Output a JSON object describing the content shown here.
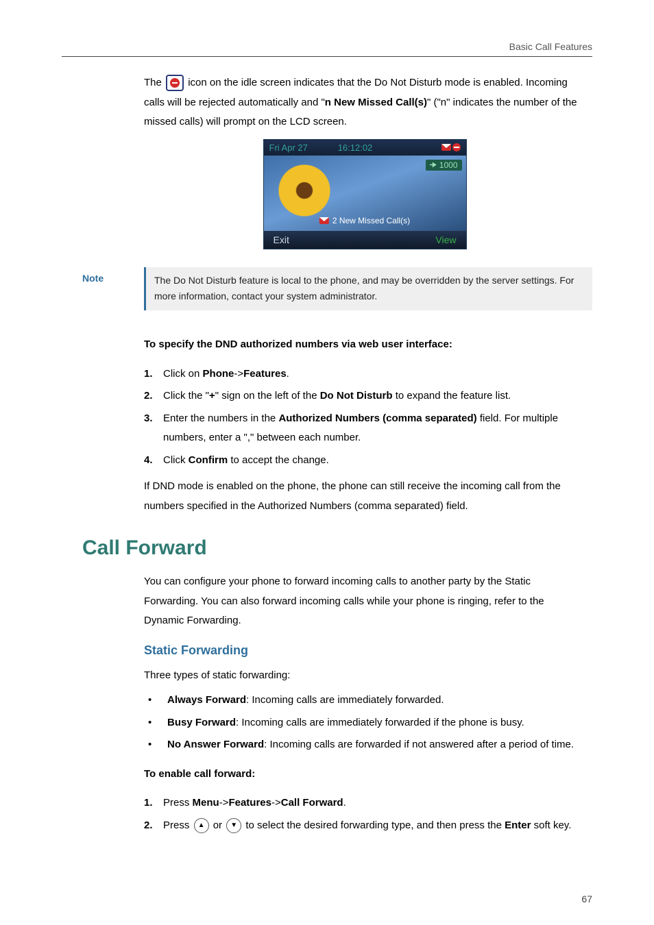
{
  "header": {
    "chapter": "Basic Call Features"
  },
  "intro": {
    "before_icon": "The ",
    "after_icon": " icon on the idle screen indicates that the Do Not Disturb mode is enabled. Incoming calls will be rejected automatically and \"",
    "missed_label": "n New Missed Call(s)",
    "after_missed": "\" (\"n\" indicates the number of the missed calls) will prompt on the LCD screen."
  },
  "phone": {
    "date": "Fri Apr 27",
    "time": "16:12:02",
    "extension": "1000",
    "missed_text": "2 New Missed Call(s)",
    "btn_exit": "Exit",
    "btn_view": "View"
  },
  "note": {
    "label": "Note",
    "text": "The Do Not Disturb feature is local to the phone, and may be overridden by the server settings. For more information, contact your system administrator."
  },
  "dnd_auth": {
    "heading": "To specify the DND authorized numbers via web user interface:",
    "steps": [
      {
        "pre": "Click on ",
        "b1": "Phone",
        "mid": "->",
        "b2": "Features",
        "post": "."
      },
      {
        "pre": "Click the \"",
        "b1": "+",
        "mid": "\" sign on the left of the ",
        "b2": "Do Not Disturb",
        "post": " to expand the feature list."
      },
      {
        "pre": "Enter the numbers in the ",
        "b1": "Authorized Numbers (comma separated)",
        "mid": " field. For multiple numbers, enter a \",\" between each number.",
        "b2": "",
        "post": ""
      },
      {
        "pre": "Click ",
        "b1": "Confirm",
        "mid": " to accept the change.",
        "b2": "",
        "post": ""
      }
    ],
    "footer": "If DND mode is enabled on the phone, the phone can still receive the incoming call from the numbers specified in the Authorized Numbers (comma separated) field."
  },
  "call_forward": {
    "title": "Call Forward",
    "intro": "You can configure your phone to forward incoming calls to another party by the Static Forwarding. You can also forward incoming calls while your phone is ringing, refer to the Dynamic Forwarding.",
    "static_heading": "Static Forwarding",
    "static_intro": "Three types of static forwarding:",
    "types": [
      {
        "name": "Always Forward",
        "desc": ": Incoming calls are immediately forwarded."
      },
      {
        "name": "Busy Forward",
        "desc": ": Incoming calls are immediately forwarded if the phone is busy."
      },
      {
        "name": "No Answer Forward",
        "desc": ": Incoming calls are forwarded if not answered after a period of time."
      }
    ],
    "enable_heading": "To enable call forward:",
    "enable_steps": {
      "s1_pre": "Press ",
      "s1_b1": "Menu",
      "s1_m1": "->",
      "s1_b2": "Features",
      "s1_m2": "->",
      "s1_b3": "Call Forward",
      "s1_post": ".",
      "s2_pre": "Press ",
      "s2_mid": " or ",
      "s2_post1": " to select the desired forwarding type, and then press the ",
      "s2_b": "Enter",
      "s2_post2": " soft key."
    }
  },
  "page_number": "67"
}
